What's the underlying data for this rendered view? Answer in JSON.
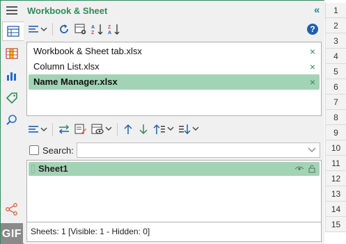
{
  "pane": {
    "title": "Workbook & Sheet",
    "collapse_glyph": "«"
  },
  "left_nav": {
    "items": [
      {
        "icon": "workbook-sheet-icon",
        "active": true
      },
      {
        "icon": "column-list-icon"
      },
      {
        "icon": "chart-icon"
      },
      {
        "icon": "tag-icon"
      },
      {
        "icon": "find-icon"
      },
      {
        "icon": "share-icon"
      }
    ],
    "gif_label": "GIF"
  },
  "workbook_toolbar": {
    "items": [
      "list-options-icon",
      "refresh-icon",
      "settings-icon",
      "sort-ascending-icon",
      "sort-descending-icon"
    ],
    "help_label": "?"
  },
  "workbooks": [
    {
      "name": "Workbook & Sheet tab.xlsx",
      "selected": false
    },
    {
      "name": "Column List.xlsx",
      "selected": false
    },
    {
      "name": "Name Manager.xlsx",
      "selected": true
    }
  ],
  "close_glyph": "×",
  "sheet_toolbar": {
    "items": [
      "list-options-icon",
      "toggle-icon",
      "edit-icon",
      "view-icon",
      "move-up-icon",
      "move-down-icon",
      "sort-icon",
      "sort-order-icon"
    ]
  },
  "search": {
    "label": "Search:",
    "value": ""
  },
  "sheets": [
    {
      "name": "Sheet1"
    }
  ],
  "status": "Sheets: 1  [Visible: 1 - Hidden: 0]",
  "row_numbers": [
    "1",
    "2",
    "3",
    "4",
    "5",
    "6",
    "7",
    "8",
    "9",
    "10",
    "11",
    "12",
    "13",
    "14",
    "15"
  ],
  "colors": {
    "accent": "#2e8b57",
    "selection": "#a3d3b5",
    "help": "#1f5fae"
  }
}
